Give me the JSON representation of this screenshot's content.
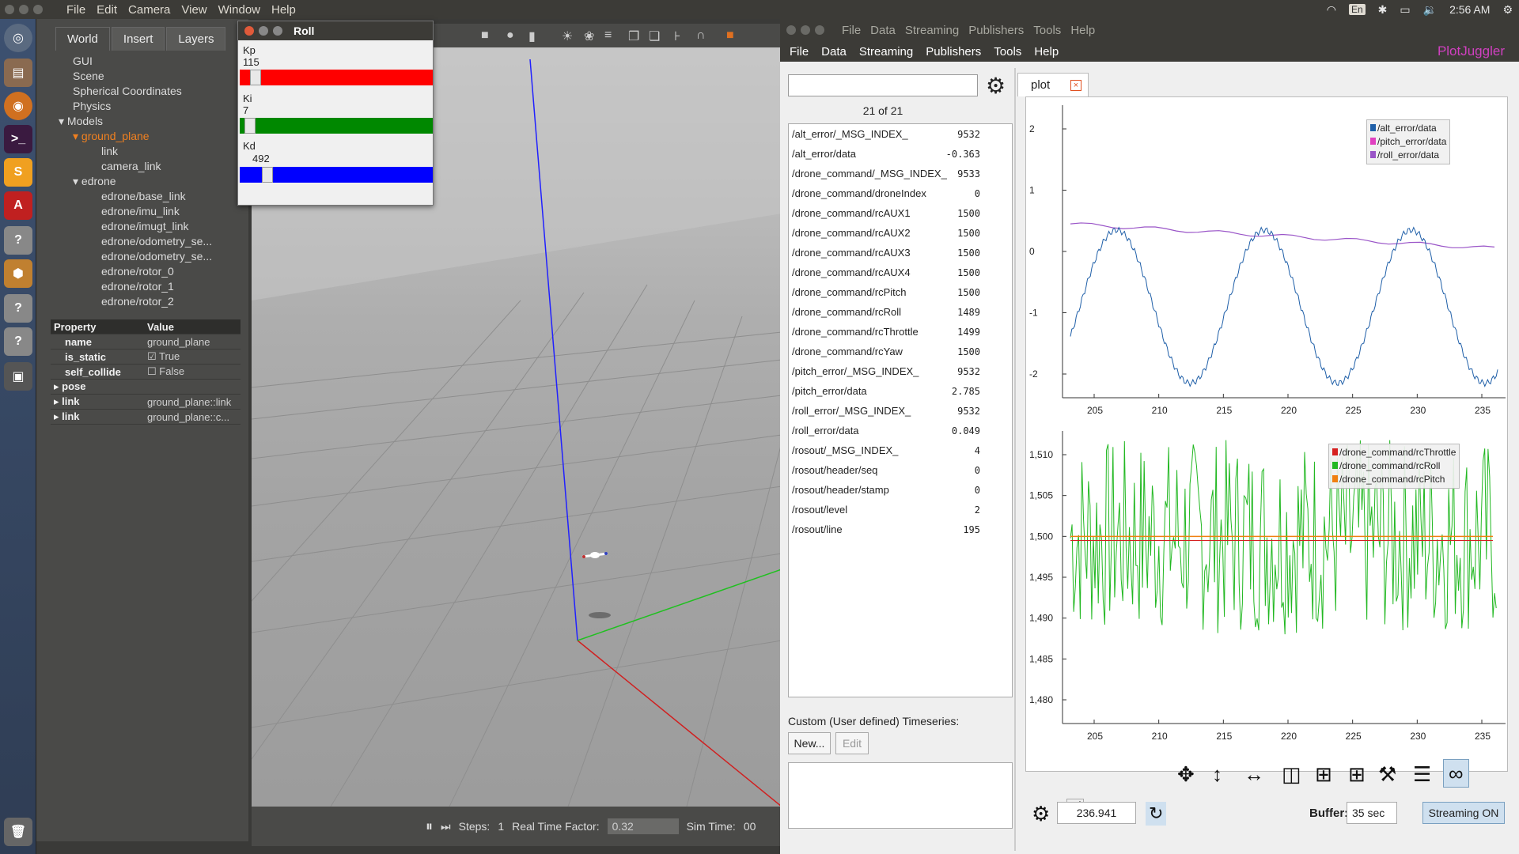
{
  "topbar": {
    "menus": [
      "File",
      "Edit",
      "Camera",
      "View",
      "Window",
      "Help"
    ],
    "kb": "En",
    "time": "2:56 AM"
  },
  "gazebo": {
    "tabs": [
      "World",
      "Insert",
      "Layers"
    ],
    "tree": [
      {
        "label": "GUI",
        "indent": 1
      },
      {
        "label": "Scene",
        "indent": 1
      },
      {
        "label": "Spherical Coordinates",
        "indent": 1
      },
      {
        "label": "Physics",
        "indent": 1
      },
      {
        "label": "Models",
        "indent": 0,
        "arrow": true
      },
      {
        "label": "ground_plane",
        "indent": 1,
        "arrow": true,
        "highlight": true
      },
      {
        "label": "link",
        "indent": 3
      },
      {
        "label": "camera_link",
        "indent": 3
      },
      {
        "label": "edrone",
        "indent": 1,
        "arrow": true
      },
      {
        "label": "edrone/base_link",
        "indent": 3
      },
      {
        "label": "edrone/imu_link",
        "indent": 3
      },
      {
        "label": "edrone/imugt_link",
        "indent": 3
      },
      {
        "label": "edrone/odometry_se...",
        "indent": 3
      },
      {
        "label": "edrone/odometry_se...",
        "indent": 3
      },
      {
        "label": "edrone/rotor_0",
        "indent": 3
      },
      {
        "label": "edrone/rotor_1",
        "indent": 3
      },
      {
        "label": "edrone/rotor_2",
        "indent": 3
      }
    ],
    "prop_header": {
      "property": "Property",
      "value": "Value"
    },
    "props": [
      {
        "name": "name",
        "value": "ground_plane"
      },
      {
        "name": "is_static",
        "value": "True",
        "check": true
      },
      {
        "name": "self_collide",
        "value": "False",
        "check": false
      },
      {
        "name": "pose",
        "value": "",
        "arrow": true
      },
      {
        "name": "link",
        "value": "ground_plane::link",
        "arrow": true
      },
      {
        "name": "link",
        "value": "ground_plane::c...",
        "arrow": true
      }
    ],
    "bottom": {
      "steps_label": "Steps:",
      "steps": "1",
      "rtf_label": "Real Time Factor:",
      "rtf": "0.32",
      "sim_label": "Sim Time:",
      "sim": "00"
    }
  },
  "roll": {
    "title": "Roll",
    "kp_label": "Kp",
    "kp": "115",
    "kp_level": 0.03,
    "ki_label": "Ki",
    "ki": "7",
    "ki_level": 0.0,
    "kd_label": "Kd",
    "kd": "492",
    "kd_level": 0.1
  },
  "pj": {
    "title_menus": [
      "File",
      "Data",
      "Streaming",
      "Publishers",
      "Tools",
      "Help"
    ],
    "menus": [
      "File",
      "Data",
      "Streaming",
      "Publishers",
      "Tools",
      "Help"
    ],
    "brand": "PlotJuggler",
    "count": "21 of 21",
    "curves": [
      {
        "name": "/alt_error/_MSG_INDEX_",
        "value": "9532"
      },
      {
        "name": "/alt_error/data",
        "value": "-0.363"
      },
      {
        "name": "/drone_command/_MSG_INDEX_",
        "value": "9533"
      },
      {
        "name": "/drone_command/droneIndex",
        "value": "0"
      },
      {
        "name": "/drone_command/rcAUX1",
        "value": "1500"
      },
      {
        "name": "/drone_command/rcAUX2",
        "value": "1500"
      },
      {
        "name": "/drone_command/rcAUX3",
        "value": "1500"
      },
      {
        "name": "/drone_command/rcAUX4",
        "value": "1500"
      },
      {
        "name": "/drone_command/rcPitch",
        "value": "1500"
      },
      {
        "name": "/drone_command/rcRoll",
        "value": "1489"
      },
      {
        "name": "/drone_command/rcThrottle",
        "value": "1499"
      },
      {
        "name": "/drone_command/rcYaw",
        "value": "1500"
      },
      {
        "name": "/pitch_error/_MSG_INDEX_",
        "value": "9532"
      },
      {
        "name": "/pitch_error/data",
        "value": "2.785"
      },
      {
        "name": "/roll_error/_MSG_INDEX_",
        "value": "9532"
      },
      {
        "name": "/roll_error/data",
        "value": "0.049"
      },
      {
        "name": "/rosout/_MSG_INDEX_",
        "value": "4"
      },
      {
        "name": "/rosout/header/seq",
        "value": "0"
      },
      {
        "name": "/rosout/header/stamp",
        "value": "0"
      },
      {
        "name": "/rosout/level",
        "value": "2"
      },
      {
        "name": "/rosout/line",
        "value": "195"
      }
    ],
    "custom_label": "Custom (User defined) Timeseries:",
    "new_btn": "New...",
    "edit_btn": "Edit",
    "plot_tab": "plot",
    "time_value": "236.941",
    "buffer_label": "Buffer:",
    "buffer_value": "35 sec",
    "streaming_btn": "Streaming ON",
    "legend1": [
      {
        "name": "/alt_error/data",
        "color": "#1f5fa8"
      },
      {
        "name": "/pitch_error/data",
        "color": "#e040c0"
      },
      {
        "name": "/roll_error/data",
        "color": "#9a55c8"
      }
    ],
    "legend2": [
      {
        "name": "/drone_command/rcThrottle",
        "color": "#d62020"
      },
      {
        "name": "/drone_command/rcRoll",
        "color": "#22b822"
      },
      {
        "name": "/drone_command/rcPitch",
        "color": "#f08010"
      }
    ],
    "xticks": [
      "205",
      "210",
      "215",
      "220",
      "225",
      "230",
      "235"
    ],
    "yticks1": [
      "2",
      "1",
      "0",
      "-1",
      "-2"
    ],
    "yticks2": [
      "1,510",
      "1,505",
      "1,500",
      "1,495",
      "1,490",
      "1,485",
      "1,480"
    ]
  }
}
